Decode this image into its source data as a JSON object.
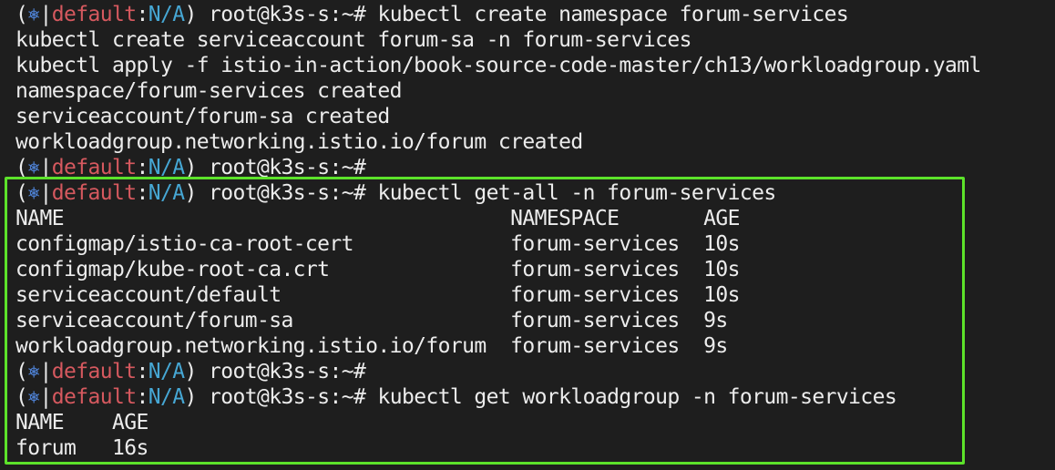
{
  "prompt": {
    "open": "(",
    "icon": "⎈",
    "bar": "|",
    "context": "default",
    "colon": ":",
    "namespace": "N/A",
    "close": ")",
    "user_host": " root@k3s-s:~# "
  },
  "lines": [
    {
      "type": "prompt",
      "command": "kubectl create namespace forum-services"
    },
    {
      "type": "output",
      "text": "kubectl create serviceaccount forum-sa -n forum-services"
    },
    {
      "type": "output",
      "text": "kubectl apply -f istio-in-action/book-source-code-master/ch13/workloadgroup.yaml"
    },
    {
      "type": "output",
      "text": "namespace/forum-services created"
    },
    {
      "type": "output",
      "text": "serviceaccount/forum-sa created"
    },
    {
      "type": "output",
      "text": "workloadgroup.networking.istio.io/forum created"
    },
    {
      "type": "prompt",
      "command": ""
    },
    {
      "type": "prompt",
      "command": "kubectl get-all -n forum-services"
    },
    {
      "type": "output",
      "text": "NAME                                     NAMESPACE       AGE"
    },
    {
      "type": "output",
      "text": "configmap/istio-ca-root-cert             forum-services  10s"
    },
    {
      "type": "output",
      "text": "configmap/kube-root-ca.crt               forum-services  10s"
    },
    {
      "type": "output",
      "text": "serviceaccount/default                   forum-services  10s"
    },
    {
      "type": "output",
      "text": "serviceaccount/forum-sa                  forum-services  9s"
    },
    {
      "type": "output",
      "text": "workloadgroup.networking.istio.io/forum  forum-services  9s"
    },
    {
      "type": "prompt",
      "command": ""
    },
    {
      "type": "prompt",
      "command": "kubectl get workloadgroup -n forum-services"
    },
    {
      "type": "output",
      "text": "NAME    AGE"
    },
    {
      "type": "output",
      "text": "forum   16s"
    }
  ],
  "colors": {
    "background": "#1e1e1e",
    "foreground": "#ececec",
    "context": "#d6595f",
    "namespace": "#46a7d4",
    "icon": "#4d7fd0",
    "highlight": "#5ce22a"
  }
}
